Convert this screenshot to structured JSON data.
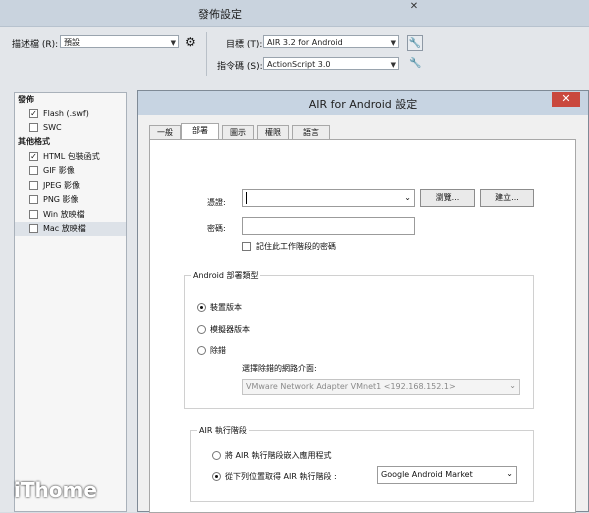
{
  "publish": {
    "title": "發佈設定",
    "close_glyph": "✕",
    "profile_label": "描述檔 (R):",
    "profile_value": "預設",
    "target_label": "目標 (T):",
    "target_value": "AIR 3.2 for Android",
    "script_label": "指令碼 (S):",
    "script_value": "ActionScript 3.0"
  },
  "formats": {
    "publish_header": "發佈",
    "other_header": "其他格式",
    "items": [
      {
        "label": "Flash (.swf)",
        "checked": true
      },
      {
        "label": "SWC",
        "checked": false
      },
      {
        "label": "HTML 包裝函式",
        "checked": true
      },
      {
        "label": "GIF 影像",
        "checked": false
      },
      {
        "label": "JPEG 影像",
        "checked": false
      },
      {
        "label": "PNG 影像",
        "checked": false
      },
      {
        "label": "Win 放映檔",
        "checked": false
      },
      {
        "label": "Mac 放映檔",
        "checked": false
      }
    ]
  },
  "air_dialog": {
    "title": "AIR for Android 設定",
    "close_glyph": "✕",
    "tabs": [
      "一般",
      "部署",
      "圖示",
      "權限",
      "語言"
    ],
    "active_tab": "部署",
    "cert_label": "憑證:",
    "cert_value": "",
    "browse_label": "瀏覽...",
    "create_label": "建立...",
    "password_label": "密碼:",
    "password_value": "",
    "remember_label": "記住此工作階段的密碼",
    "remember_checked": false,
    "deploy_group_title": "Android 部署類型",
    "deploy_options": [
      "裝置版本",
      "模擬器版本",
      "除錯"
    ],
    "deploy_selected": "裝置版本",
    "network_label": "選擇除錯的網路介面:",
    "network_value": "VMware Network Adapter VMnet1 <192.168.152.1>",
    "runtime_group_title": "AIR 執行階段",
    "runtime_options": [
      "將 AIR 執行階段嵌入應用程式",
      "從下列位置取得 AIR 執行階段 :"
    ],
    "runtime_selected": "從下列位置取得 AIR 執行階段 :",
    "runtime_source": "Google Android Market"
  },
  "watermark": "iThome"
}
